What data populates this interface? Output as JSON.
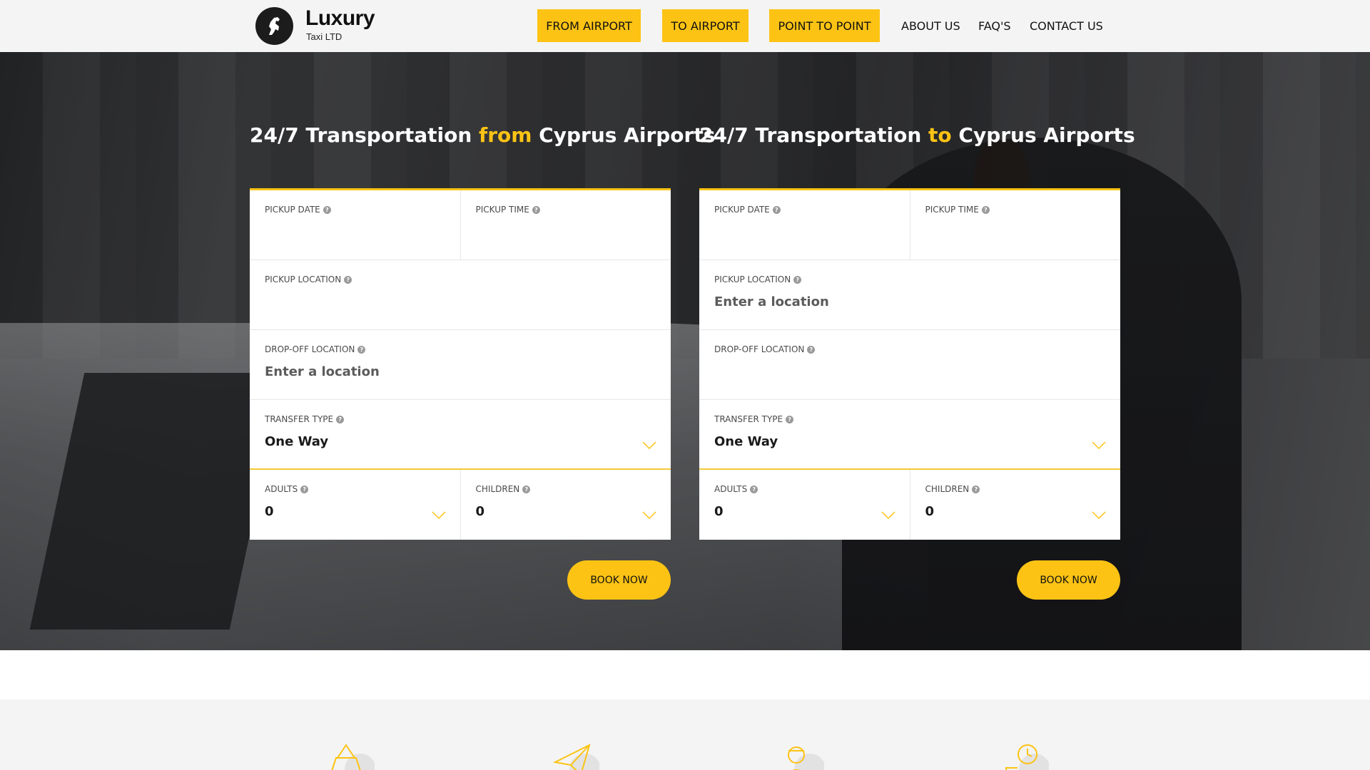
{
  "header": {
    "brand_name": "Luxury",
    "brand_sub": "Taxi LTD",
    "nav_buttons": [
      "FROM AIRPORT",
      "TO AIRPORT",
      "POINT TO POINT"
    ],
    "nav_links": [
      "ABOUT US",
      "FAQ'S",
      "CONTACT US"
    ]
  },
  "forms": [
    {
      "title_pre": "24/7 Transportation ",
      "title_hl": "from",
      "title_post": " Cyprus Airports",
      "pickup_date_label": "PICKUP DATE",
      "pickup_time_label": "PICKUP TIME",
      "pickup_location_label": "PICKUP LOCATION",
      "pickup_location_placeholder": "",
      "dropoff_location_label": "DROP-OFF LOCATION",
      "dropoff_location_placeholder": "Enter a location",
      "transfer_type_label": "TRANSFER TYPE",
      "transfer_type_value": "One Way",
      "adults_label": "ADULTS",
      "adults_value": "0",
      "children_label": "CHILDREN",
      "children_value": "0",
      "book_label": "BOOK NOW"
    },
    {
      "title_pre": "24/7 Transportation ",
      "title_hl": "to",
      "title_post": " Cyprus Airports",
      "pickup_date_label": "PICKUP DATE",
      "pickup_time_label": "PICKUP TIME",
      "pickup_location_label": "PICKUP LOCATION",
      "pickup_location_placeholder": "Enter a location",
      "dropoff_location_label": "DROP-OFF LOCATION",
      "dropoff_location_placeholder": "",
      "transfer_type_label": "TRANSFER TYPE",
      "transfer_type_value": "One Way",
      "adults_label": "ADULTS",
      "adults_value": "0",
      "children_label": "CHILDREN",
      "children_value": "0",
      "book_label": "BOOK NOW"
    }
  ],
  "help_glyph": "?",
  "colors": {
    "accent": "#fcc314",
    "header_bg": "#f4f4f4",
    "text": "#111111"
  },
  "icons": [
    "horse-logo-icon",
    "help-icon",
    "chevron-down-icon",
    "car-icon",
    "paper-plane-icon",
    "driver-icon",
    "clock-icon"
  ]
}
